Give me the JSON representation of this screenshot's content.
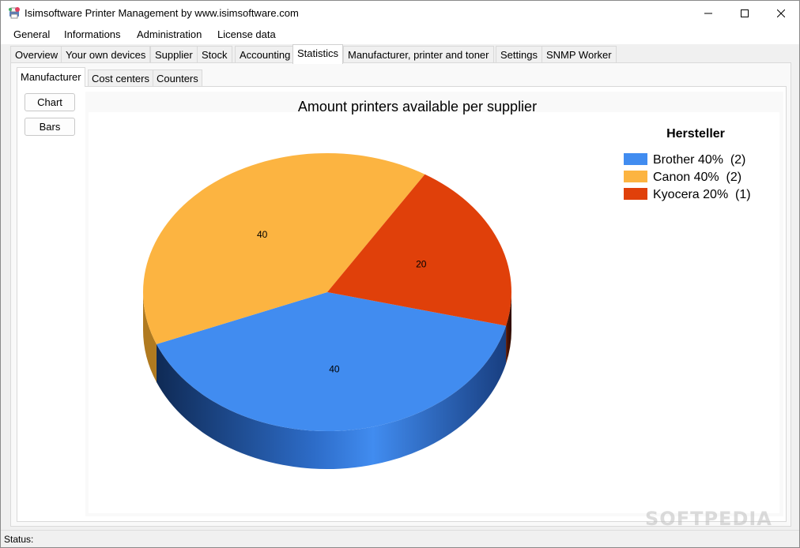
{
  "window": {
    "title": "Isimsoftware Printer Management by www.isimsoftware.com"
  },
  "menu": [
    "General",
    "Informations",
    "Administration",
    "License data"
  ],
  "tabs": [
    {
      "label": "Overview"
    },
    {
      "label": "Your own devices"
    },
    {
      "label": "Supplier"
    },
    {
      "label": "Stock"
    },
    {
      "label": "Accounting"
    },
    {
      "label": "Statistics",
      "active": true
    },
    {
      "label": "Manufacturer, printer and toner"
    },
    {
      "label": "Settings"
    },
    {
      "label": "SNMP Worker"
    }
  ],
  "subtabs": [
    {
      "label": "Manufacturer",
      "active": true
    },
    {
      "label": "Cost centers"
    },
    {
      "label": "Counters"
    }
  ],
  "buttons": {
    "chart": "Chart",
    "bars": "Bars"
  },
  "chart_data": {
    "type": "pie",
    "title": "Amount printers available per supplier",
    "legend_title": "Hersteller",
    "legend_position": "top-right",
    "style": "3d",
    "series": [
      {
        "name": "Brother",
        "percent": 40,
        "count": 2,
        "label": "40",
        "legend": "Brother 40%  (2)",
        "color": "#418cf0"
      },
      {
        "name": "Canon",
        "percent": 40,
        "count": 2,
        "label": "40",
        "legend": "Canon 40%  (2)",
        "color": "#fcb441"
      },
      {
        "name": "Kyocera",
        "percent": 20,
        "count": 1,
        "label": "20",
        "legend": "Kyocera 20%  (1)",
        "color": "#e0400a"
      }
    ]
  },
  "status": {
    "label": "Status:"
  },
  "watermark": "SOFTPEDIA"
}
